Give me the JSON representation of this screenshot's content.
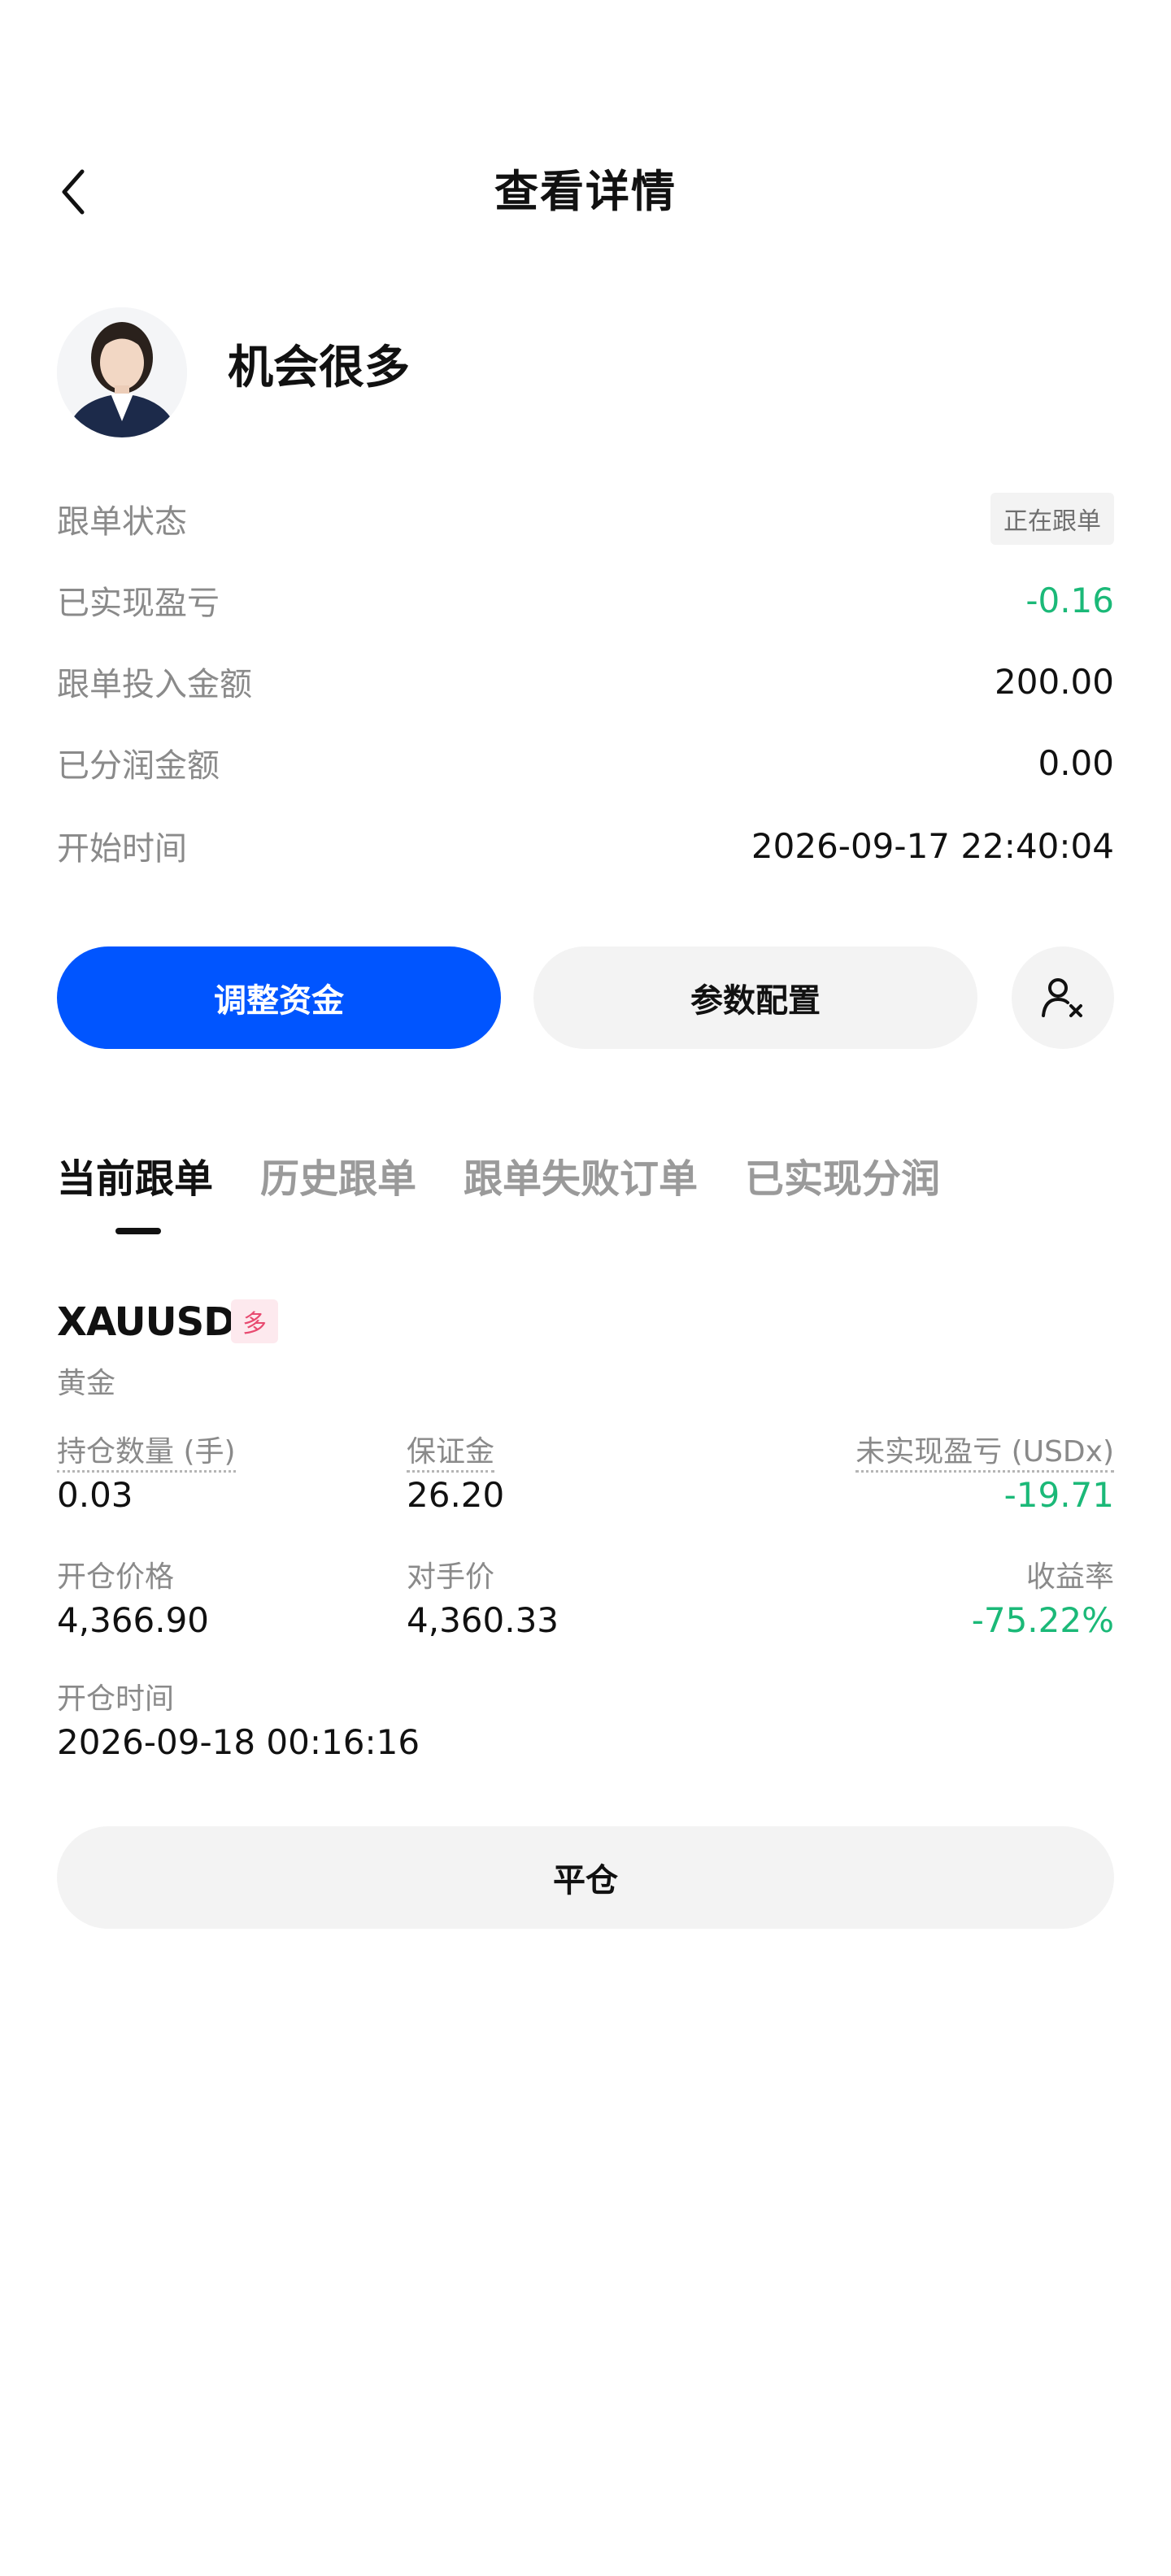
{
  "header": {
    "title": "查看详情",
    "back_icon": "chevron-left-icon"
  },
  "trader": {
    "name": "机会很多",
    "avatar_icon": "avatar-image"
  },
  "info": {
    "status_label": "跟单状态",
    "status_value": "正在跟单",
    "realized_pnl_label": "已实现盈亏",
    "realized_pnl_value": "-0.16",
    "invest_label": "跟单投入金额",
    "invest_value": "200.00",
    "profit_share_label": "已分润金额",
    "profit_share_value": "0.00",
    "start_time_label": "开始时间",
    "start_time_value": "2026-09-17 22:40:04"
  },
  "actions": {
    "adjust_label": "调整资金",
    "config_label": "参数配置",
    "unfollow_icon": "user-remove-icon"
  },
  "tabs": [
    {
      "label": "当前跟单"
    },
    {
      "label": "历史跟单"
    },
    {
      "label": "跟单失败订单"
    },
    {
      "label": "已实现分润"
    }
  ],
  "position": {
    "symbol": "XAUUSD",
    "side": "多",
    "name": "黄金",
    "qty_label": "持仓数量 (手)",
    "qty_value": "0.03",
    "margin_label": "保证金",
    "margin_value": "26.20",
    "upnl_label": "未实现盈亏 (USDx)",
    "upnl_value": "-19.71",
    "open_price_label": "开仓价格",
    "open_price_value": "4,366.90",
    "counter_price_label": "对手价",
    "counter_price_value": "4,360.33",
    "yield_label": "收益率",
    "yield_value": "-75.22%",
    "open_time_label": "开仓时间",
    "open_time_value": "2026-09-18 00:16:16",
    "close_label": "平仓"
  },
  "colors": {
    "accent": "#0055ff",
    "profit_negative": "#1bb978",
    "side_badge_bg": "#fde9ee",
    "side_badge_text": "#e84a70"
  }
}
